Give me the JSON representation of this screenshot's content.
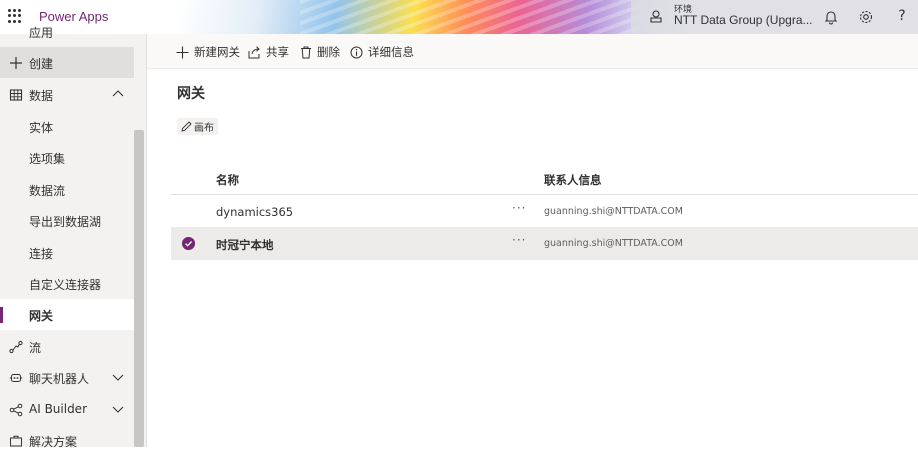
{
  "header": {
    "app_title": "Power Apps",
    "environment_label": "环境",
    "environment_name": "NTT Data Group (Upgra...",
    "icons": [
      "waffle-icon",
      "environment-icon",
      "bell-icon",
      "settings-icon",
      "help-icon"
    ],
    "help_glyph": "?"
  },
  "sidebar": {
    "items": [
      {
        "label": "应用",
        "icon": "apps-icon"
      },
      {
        "label": "创建",
        "icon": "plus-icon"
      },
      {
        "label": "数据",
        "icon": "table-icon",
        "expanded": true
      },
      {
        "label": "实体"
      },
      {
        "label": "选项集"
      },
      {
        "label": "数据流"
      },
      {
        "label": "导出到数据湖"
      },
      {
        "label": "连接"
      },
      {
        "label": "自定义连接器"
      },
      {
        "label": "网关",
        "active": true
      },
      {
        "label": "流",
        "icon": "flow-icon"
      },
      {
        "label": "聊天机器人",
        "icon": "chatbot-icon",
        "expandable": true
      },
      {
        "label": "AI Builder",
        "icon": "ai-builder-icon",
        "expandable": true
      },
      {
        "label": "解决方案",
        "icon": "solutions-icon"
      }
    ]
  },
  "commands": {
    "new_gateway": "新建网关",
    "share": "共享",
    "delete": "删除",
    "details": "详细信息"
  },
  "page": {
    "title": "网关",
    "canvas_button": "画布"
  },
  "table": {
    "columns": {
      "name": "名称",
      "contact": "联系人信息"
    },
    "more_glyph": "···",
    "rows": [
      {
        "name": "dynamics365",
        "contact": "guanning.shi@NTTDATA.COM",
        "selected": false
      },
      {
        "name": "时冠宁本地",
        "contact": "guanning.shi@NTTDATA.COM",
        "selected": true
      }
    ]
  },
  "colors": {
    "brand": "#742774",
    "sidebar_bg": "#f3f2f1",
    "selected_row": "#edebe9"
  }
}
